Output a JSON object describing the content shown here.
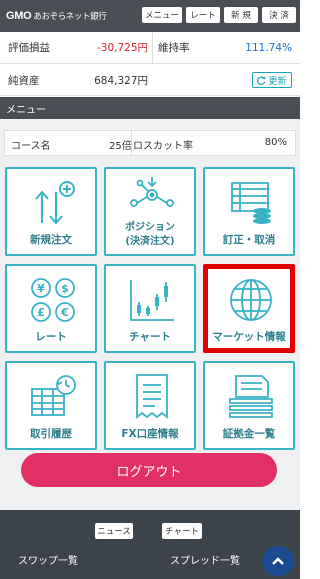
{
  "header": {
    "brand_gmo": "GMO",
    "brand_name": "あおぞらネット銀行",
    "buttons": [
      "メニュー",
      "レート",
      "新 規",
      "決 済"
    ]
  },
  "summary": {
    "pl_label": "評価損益",
    "pl_value": "-30,725円",
    "margin_ratio_label": "維持率",
    "margin_ratio_value": "111.74%",
    "net_assets_label": "純資産",
    "net_assets_value": "684,327円",
    "refresh_label": "更新"
  },
  "menu": {
    "title": "メニュー",
    "course_label": "コース名",
    "course_value": "25倍",
    "losscut_label": "ロスカット率",
    "losscut_value": "80%",
    "tiles": [
      {
        "label": "新規注文",
        "icon": "new-order-icon"
      },
      {
        "label": "ポジション",
        "label2": "(決済注文)",
        "icon": "position-icon"
      },
      {
        "label": "訂正・取消",
        "icon": "edit-cancel-icon"
      },
      {
        "label": "レート",
        "icon": "rate-currency-icon"
      },
      {
        "label": "チャート",
        "icon": "candlestick-chart-icon"
      },
      {
        "label": "マーケット情報",
        "icon": "globe-icon"
      },
      {
        "label": "取引履歴",
        "icon": "history-icon"
      },
      {
        "label": "FX口座情報",
        "icon": "receipt-icon"
      },
      {
        "label": "証拠金一覧",
        "icon": "document-stack-icon"
      }
    ],
    "logout_label": "ログアウト"
  },
  "footer": {
    "news_label": "ニュース",
    "chart_label": "チャート",
    "swap_label": "スワップ一覧",
    "spread_label": "スプレッド一覧"
  },
  "colors": {
    "header_bg": "#4a4f56",
    "tile_border": "#39b3c6",
    "highlight": "#e00000",
    "logout": "#e23066",
    "negative": "#d9232d",
    "positive": "#1c6fc4"
  }
}
